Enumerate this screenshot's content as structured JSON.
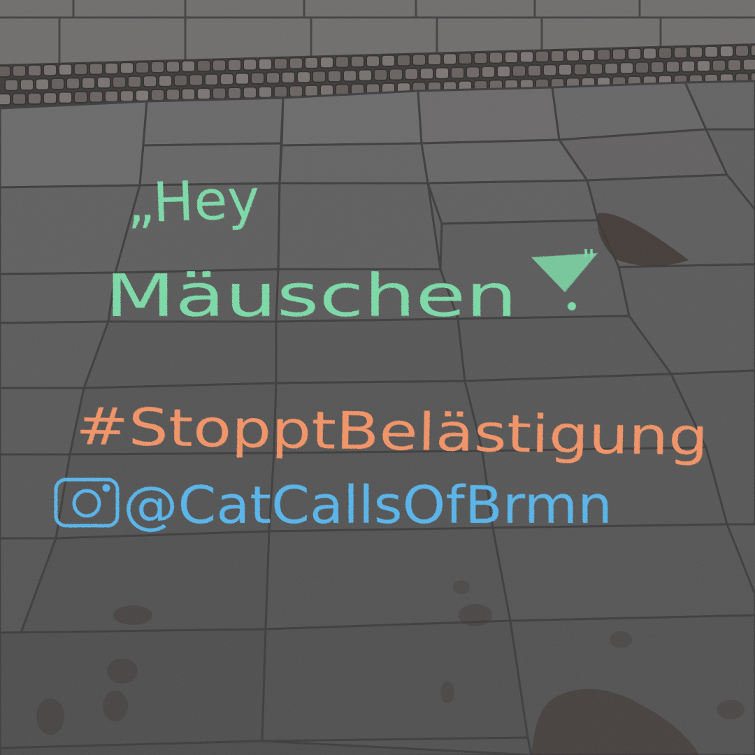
{
  "photo": {
    "subject": "chalk-writing-on-pavement",
    "colors": {
      "pavement": "#5a5959",
      "pavement_light": "#6e6c6b",
      "cobble": "#6a6361",
      "joint": "#3b3b3c",
      "chalk_green": "#7fd8a8",
      "chalk_orange": "#f0956a",
      "chalk_blue": "#5cb5e8",
      "wet_stain": "#3a312e"
    },
    "chalk": {
      "quote_line1": "„Hey",
      "quote_line2": "Mäuschen",
      "quote_close": "!\"",
      "hashtag": "#StopptBelästigung",
      "handle": "@CatCallsOfBrmn",
      "handle_icon": "instagram-icon"
    }
  }
}
